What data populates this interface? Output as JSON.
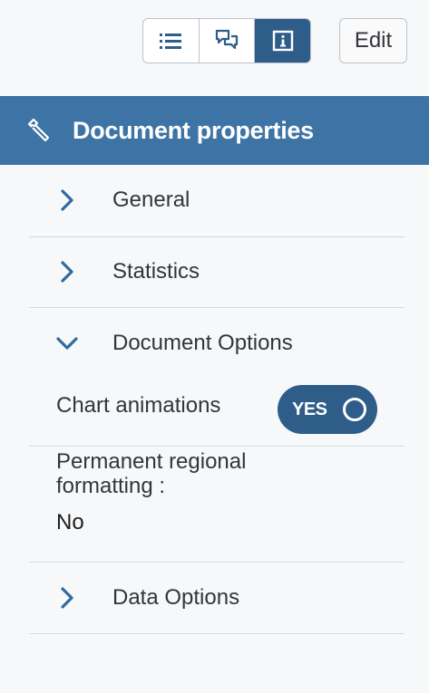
{
  "toolbar": {
    "buttons": [
      {
        "icon": "list-icon",
        "active": false
      },
      {
        "icon": "comments-icon",
        "active": false
      },
      {
        "icon": "info-icon",
        "active": true
      }
    ],
    "edit_label": "Edit"
  },
  "header": {
    "icon": "wrench-icon",
    "title": "Document properties"
  },
  "sections": [
    {
      "label": "General",
      "expanded": false
    },
    {
      "label": "Statistics",
      "expanded": false
    },
    {
      "label": "Document Options",
      "expanded": true
    },
    {
      "label": "Data Options",
      "expanded": false
    }
  ],
  "document_options": {
    "chart_animations_label": "Chart animations",
    "chart_animations_toggle": "YES",
    "regional_label_line1": "Permanent regional",
    "regional_label_line2": "formatting :",
    "regional_value": "No"
  },
  "colors": {
    "accent": "#2f5d8a",
    "header_bg": "#3e74a5",
    "chevron": "#2f6aa3"
  }
}
